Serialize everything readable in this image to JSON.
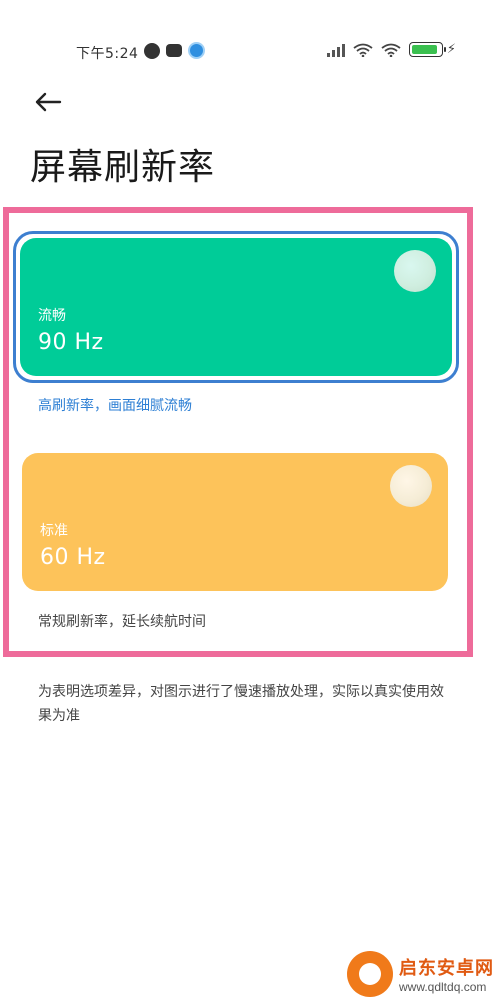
{
  "status_bar": {
    "time": "下午5:24",
    "icons_left": [
      "app-notification-icon",
      "gamepad-icon",
      "browser-icon"
    ],
    "icons_right": [
      "signal-icon",
      "wifi-icon",
      "wifi-icon",
      "battery-icon",
      "charging-icon"
    ],
    "battery_level": 0.9
  },
  "header": {
    "back_icon": "arrow-left-icon",
    "title": "屏幕刷新率"
  },
  "options": [
    {
      "name": "流畅",
      "value": "90 Hz",
      "description": "高刷新率，画面细腻流畅",
      "color": "#00cc98",
      "selected": true
    },
    {
      "name": "标准",
      "value": "60 Hz",
      "description": "常规刷新率，延长续航时间",
      "color": "#fdc35a",
      "selected": false
    }
  ],
  "footnote": "为表明选项差异，对图示进行了慢速播放处理，实际以真实使用效果为准",
  "colors": {
    "highlight_frame": "#ee6b9a",
    "selected_ring": "#3d7fd0",
    "selected_desc": "#2d7fd4"
  },
  "watermark": {
    "title": "启东安卓网",
    "url": "www.qdltdq.com"
  }
}
